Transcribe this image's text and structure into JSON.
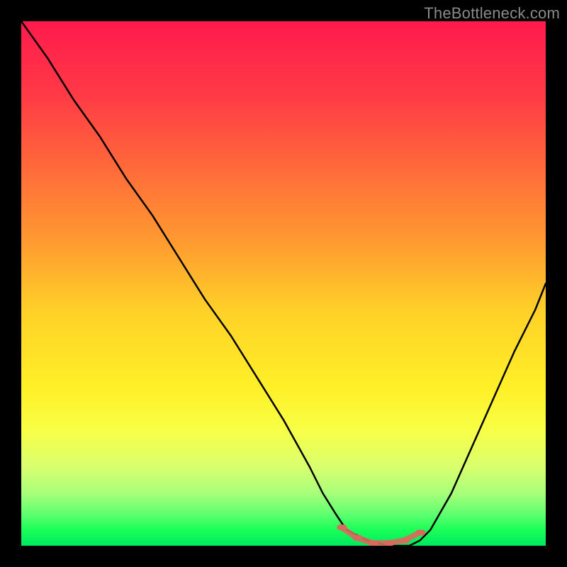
{
  "watermark": "TheBottleneck.com",
  "chart_data": {
    "type": "line",
    "title": "",
    "xlabel": "",
    "ylabel": "",
    "xlim": [
      0,
      1
    ],
    "ylim": [
      0,
      1
    ],
    "series": [
      {
        "name": "bottleneck-curve",
        "x": [
          0.0,
          0.05,
          0.1,
          0.15,
          0.2,
          0.25,
          0.3,
          0.35,
          0.4,
          0.45,
          0.5,
          0.55,
          0.575,
          0.6,
          0.62,
          0.66,
          0.7,
          0.74,
          0.76,
          0.78,
          0.82,
          0.86,
          0.9,
          0.94,
          0.98,
          1.0
        ],
        "y": [
          1.0,
          0.93,
          0.85,
          0.78,
          0.7,
          0.63,
          0.55,
          0.47,
          0.4,
          0.32,
          0.24,
          0.15,
          0.1,
          0.06,
          0.03,
          0.01,
          0.0,
          0.0,
          0.01,
          0.03,
          0.1,
          0.19,
          0.28,
          0.37,
          0.45,
          0.5
        ]
      }
    ],
    "markers": {
      "name": "highlight-band",
      "color": "#d86a5e",
      "x": [
        0.61,
        0.64,
        0.67,
        0.7,
        0.73,
        0.76
      ],
      "y": [
        0.035,
        0.015,
        0.005,
        0.005,
        0.01,
        0.025
      ]
    }
  }
}
